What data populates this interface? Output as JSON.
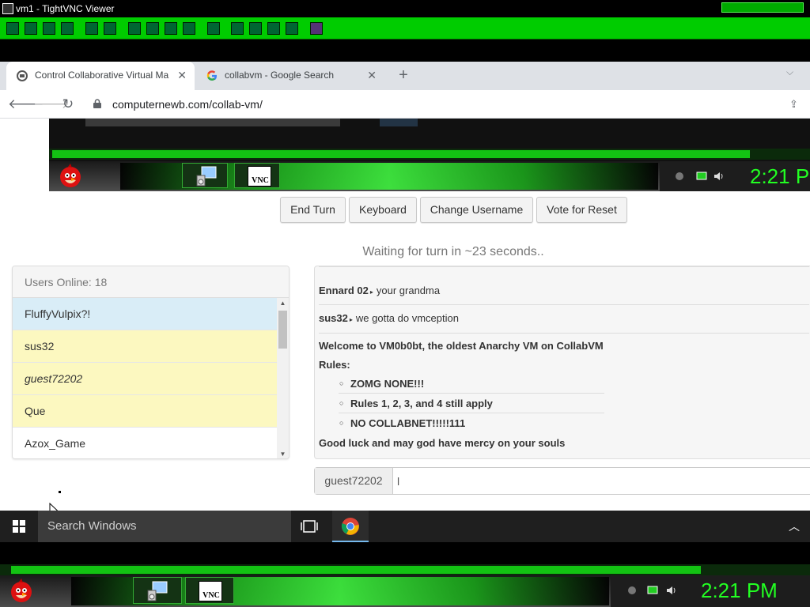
{
  "vnc": {
    "title": "vm1 - TightVNC Viewer"
  },
  "browser": {
    "tabs": [
      {
        "label": "Control Collaborative Virtual Ma",
        "favicon": "collabvm-icon"
      },
      {
        "label": "collabvm - Google Search",
        "favicon": "google-g-icon"
      }
    ],
    "address": "computernewb.com/collab-vm/"
  },
  "vm_screen": {
    "clock": "2:21 P"
  },
  "controls": {
    "end_turn": "End Turn",
    "keyboard": "Keyboard",
    "change_username": "Change Username",
    "vote_reset": "Vote for Reset"
  },
  "status": {
    "waiting": "Waiting for turn in ~23 seconds.."
  },
  "users": {
    "header": "Users Online: 18",
    "list": [
      {
        "name": "FluffyVulpix?!",
        "bg": "#d9edf7",
        "italic": false
      },
      {
        "name": "sus32",
        "bg": "#fcf8c0",
        "italic": false
      },
      {
        "name": "guest72202",
        "bg": "#fcf8c0",
        "italic": true
      },
      {
        "name": "Que",
        "bg": "#fcf8c0",
        "italic": false
      },
      {
        "name": "Azox_Game",
        "bg": "#ffffff",
        "italic": false
      }
    ]
  },
  "chat": {
    "messages": [
      {
        "user": "Ennard 02",
        "text": "your grandma"
      },
      {
        "user": "sus32",
        "text": "we gotta do vmception"
      }
    ],
    "motd": {
      "welcome": "Welcome to VM0b0bt, the oldest Anarchy VM on CollabVM",
      "rules_label": "Rules:",
      "rules": [
        "ZOMG NONE!!!",
        "Rules 1, 2, 3, and 4 still apply",
        "NO COLLABNET!!!!!111"
      ],
      "closing": "Good luck and may god have mercy on your souls"
    },
    "input_user": "guest72202",
    "input_value": "l"
  },
  "windows": {
    "search_placeholder": "Search Windows"
  },
  "outer_vm": {
    "clock": "2:21 PM"
  },
  "colors": {
    "vnc_green": "#00cc00",
    "clock_green": "#22ff22",
    "highlight_blue": "#d9edf7",
    "highlight_yellow": "#fcf8c0"
  }
}
